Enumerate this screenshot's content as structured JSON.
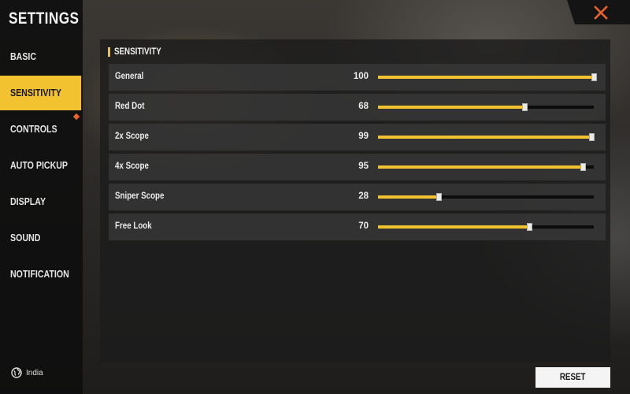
{
  "sidebar": {
    "title": "SETTINGS",
    "items": [
      {
        "label": "BASIC",
        "active": false
      },
      {
        "label": "SENSITIVITY",
        "active": true
      },
      {
        "label": "CONTROLS",
        "active": false
      },
      {
        "label": "AUTO PICKUP",
        "active": false
      },
      {
        "label": "DISPLAY",
        "active": false
      },
      {
        "label": "SOUND",
        "active": false
      },
      {
        "label": "NOTIFICATION",
        "active": false
      }
    ],
    "region": {
      "icon": "globe-icon",
      "label": "India"
    }
  },
  "close": {
    "icon": "close-icon",
    "color": "#e8632a"
  },
  "section": {
    "title": "SENSITIVITY"
  },
  "sliders": [
    {
      "label": "General",
      "value": "100",
      "level": 100
    },
    {
      "label": "Red Dot",
      "value": "68",
      "level": 68
    },
    {
      "label": "2x Scope",
      "value": "99",
      "level": 99
    },
    {
      "label": "4x Scope",
      "value": "95",
      "level": 95
    },
    {
      "label": "Sniper Scope",
      "value": "28",
      "level": 28
    },
    {
      "label": "Free Look",
      "value": "70",
      "level": 70
    }
  ],
  "reset": {
    "label": "RESET"
  },
  "colors": {
    "accent": "#f2c230",
    "close": "#e8632a",
    "track": "#0c0c0c"
  }
}
